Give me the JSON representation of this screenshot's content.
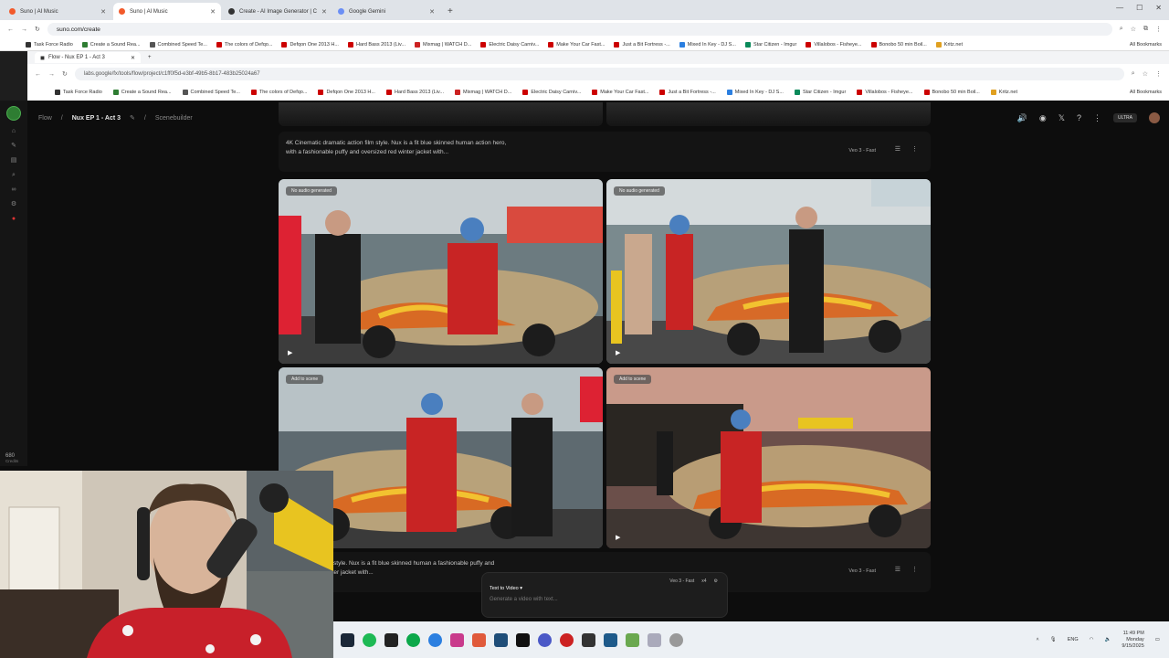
{
  "outer_browser": {
    "tabs": [
      {
        "title": "Suno | AI Music",
        "color": "#f25a2b",
        "active": false
      },
      {
        "title": "Suno | AI Music",
        "color": "#f25a2b",
        "active": true
      },
      {
        "title": "Create - AI Image Generator | C",
        "color": "#333333",
        "active": false
      },
      {
        "title": "Google Gemini",
        "color": "#6b8ff5",
        "active": false
      }
    ],
    "url": "suno.com/create",
    "bookmarks": [
      "Task Force Radio",
      "Create a Sound Rea...",
      "Combined Speed Te...",
      "The colors of Defqo...",
      "Defqon One 2013 H...",
      "Hard Bass 2013 (Liv...",
      "Mixmag | WATCH D...",
      "Electric Daisy Carniv...",
      "Make Your Car Fast...",
      "Just a Bit Fortress -...",
      "Mixed In Key - DJ S...",
      "Star Citizen - Imgur",
      "Villalobos - Fisheye...",
      "Bonobo 50 min Boil...",
      "Kritz.net"
    ],
    "all_bookmarks": "All Bookmarks"
  },
  "inner_browser": {
    "tab_title": "Flow - Nux EP 1 - Act 3",
    "url": "labs.google/fx/tools/flow/project/c1ff0f5d-e3bf-49b5-8b17-483b25024a67",
    "bookmarks": [
      "Task Force Radio",
      "Create a Sound Rea...",
      "Combined Speed Te...",
      "The colors of Defqo...",
      "Defqon One 2013 H...",
      "Hard Bass 2013 (Liv...",
      "Mixmag | WATCH D...",
      "Electric Daisy Carniv...",
      "Make Your Car Fast...",
      "Just a Bit Fortress -...",
      "Mixed In Key - DJ S...",
      "Star Citizen - Imgur",
      "Villalobos - Fisheye...",
      "Bonobo 50 min Boil...",
      "Kritz.net"
    ],
    "all_bookmarks": "All Bookmarks"
  },
  "flow": {
    "breadcrumb_root": "Flow",
    "project_name": "Nux EP 1 - Act 3",
    "scenebuilder": "Scenebuilder",
    "plan_badge": "ULTRA",
    "credits_value": "680",
    "credits_label": "Credits",
    "prompt_text": "4K Cinematic dramatic action film style. Nux is a fit blue skinned human action hero, with a fashionable puffy and oversized red winter jacket with...",
    "prompt_text_2": "amatic action film style. Nux is a fit blue skinned human a fashionable puffy and oversized red winter jacket with...",
    "model_label": "Veo 3 - Fast",
    "no_audio_badge": "No audio generated",
    "add_to_scene": "Add to scene"
  },
  "composer": {
    "mode": "Text to Video",
    "model": "Veo 3 - Fast",
    "count": "x4",
    "placeholder": "Generate a video with text..."
  },
  "taskbar": {
    "lang": "ENG",
    "time": "11:49 PM",
    "day": "Monday",
    "date": "9/15/2025"
  }
}
